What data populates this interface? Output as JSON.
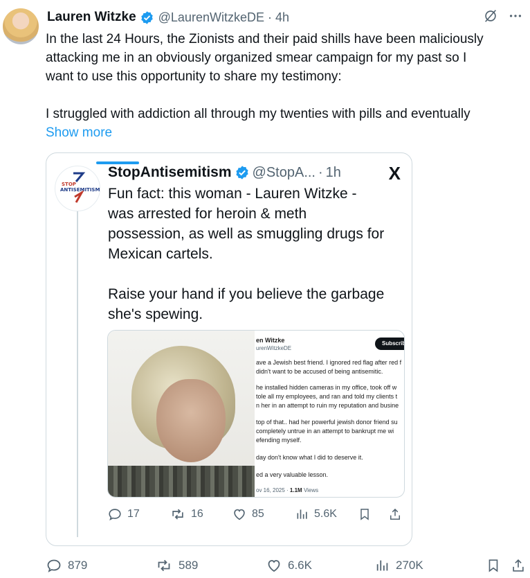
{
  "tweet": {
    "author_name": "Lauren Witzke",
    "handle": "@LaurenWitzkeDE",
    "dot": "·",
    "time": "4h",
    "text_line1": "In the last 24 Hours, the Zionists and their paid shills have been maliciously",
    "text_line2": "attacking me in an obviously organized smear campaign for my past so I",
    "text_line3": "want to use this opportunity to share my testimony:",
    "text_line4": "I struggled with addiction all through my twenties with pills and eventually",
    "show_more": "Show more",
    "stats": {
      "replies": "879",
      "reposts": "589",
      "likes": "6.6K",
      "views": "270K"
    }
  },
  "quoted": {
    "author_name": "StopAntisemitism",
    "handle": "@StopA...",
    "dot": "·",
    "time": "1h",
    "avatar_text1": "STOP",
    "avatar_text2": "ANTISEMITISM",
    "x_glyph": "X",
    "text_line1": "Fun fact: this woman - Lauren Witzke -",
    "text_line2": "was arrested for heroin & meth",
    "text_line3": "possession, as well as smuggling drugs for",
    "text_line4": "Mexican cartels.",
    "text_line5": "Raise your hand if you believe the garbage",
    "text_line6": "she's spewing.",
    "stats": {
      "replies": "17",
      "reposts": "16",
      "likes": "85",
      "views": "5.6K"
    }
  },
  "embedded_screenshot": {
    "name": "en Witzke",
    "handle": "urenWitzkeDE",
    "subscribe": "Subscrib",
    "lines": [
      "ave a Jewish best friend. I ignored red flag after red f",
      "didn't want to be accused of being antisemitic.",
      "he installed hidden cameras in my office, took off w",
      "tole all my employees, and ran and told my clients t",
      "n her in an attempt to ruin my reputation and busine",
      "top of that.. had her powerful jewish donor friend su",
      " completely untrue in an attempt to bankrupt me wi",
      "efending myself.",
      "day don't know what I did to deserve it.",
      "ed a very valuable lesson."
    ],
    "meta_date": "ov 16, 2025 · ",
    "meta_views": "1.1M",
    "meta_views_label": " Views"
  },
  "colors": {
    "accent": "#1d9bf0",
    "text": "#0f1419",
    "muted": "#536471",
    "border": "#cfd9de"
  },
  "icons": [
    "verified-badge-icon",
    "grok-icon",
    "more-icon",
    "x-logo-icon",
    "reply-icon",
    "repost-icon",
    "like-icon",
    "views-icon",
    "bookmark-icon",
    "share-icon"
  ]
}
